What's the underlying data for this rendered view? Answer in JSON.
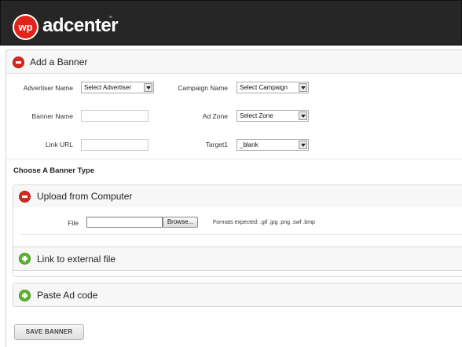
{
  "brand": {
    "badge": "wp",
    "name": "adcenter",
    "tm": "™"
  },
  "add_banner": {
    "title": "Add a Banner",
    "fields": {
      "advertiser_label": "Advertiser Name",
      "advertiser_value": "Select Advertiser",
      "campaign_label": "Campaign Name",
      "campaign_value": "Select Campaign",
      "banner_name_label": "Banner Name",
      "banner_name_value": "",
      "ad_zone_label": "Ad Zone",
      "ad_zone_value": "Select Zone",
      "link_url_label": "Link URL",
      "link_url_value": "",
      "target_label": "Target1",
      "target_value": "_blank"
    }
  },
  "banner_type": {
    "title": "Choose A Banner Type",
    "upload": {
      "title": "Upload from Computer",
      "file_label": "File",
      "file_value": "",
      "browse_label": "Browse...",
      "formats": "Formats expected: .gif .jpg .png .swf .bmp"
    },
    "link_external": {
      "title": "Link to external file"
    },
    "paste_code": {
      "title": "Paste Ad code"
    }
  },
  "actions": {
    "save_label": "SAVE BANNER"
  },
  "icons": {
    "expanded": "minus-circle-icon",
    "collapsed": "plus-circle-icon"
  },
  "colors": {
    "header_bg": "#262626",
    "brand_red": "#e2231a",
    "expand_green": "#5cb82d"
  }
}
